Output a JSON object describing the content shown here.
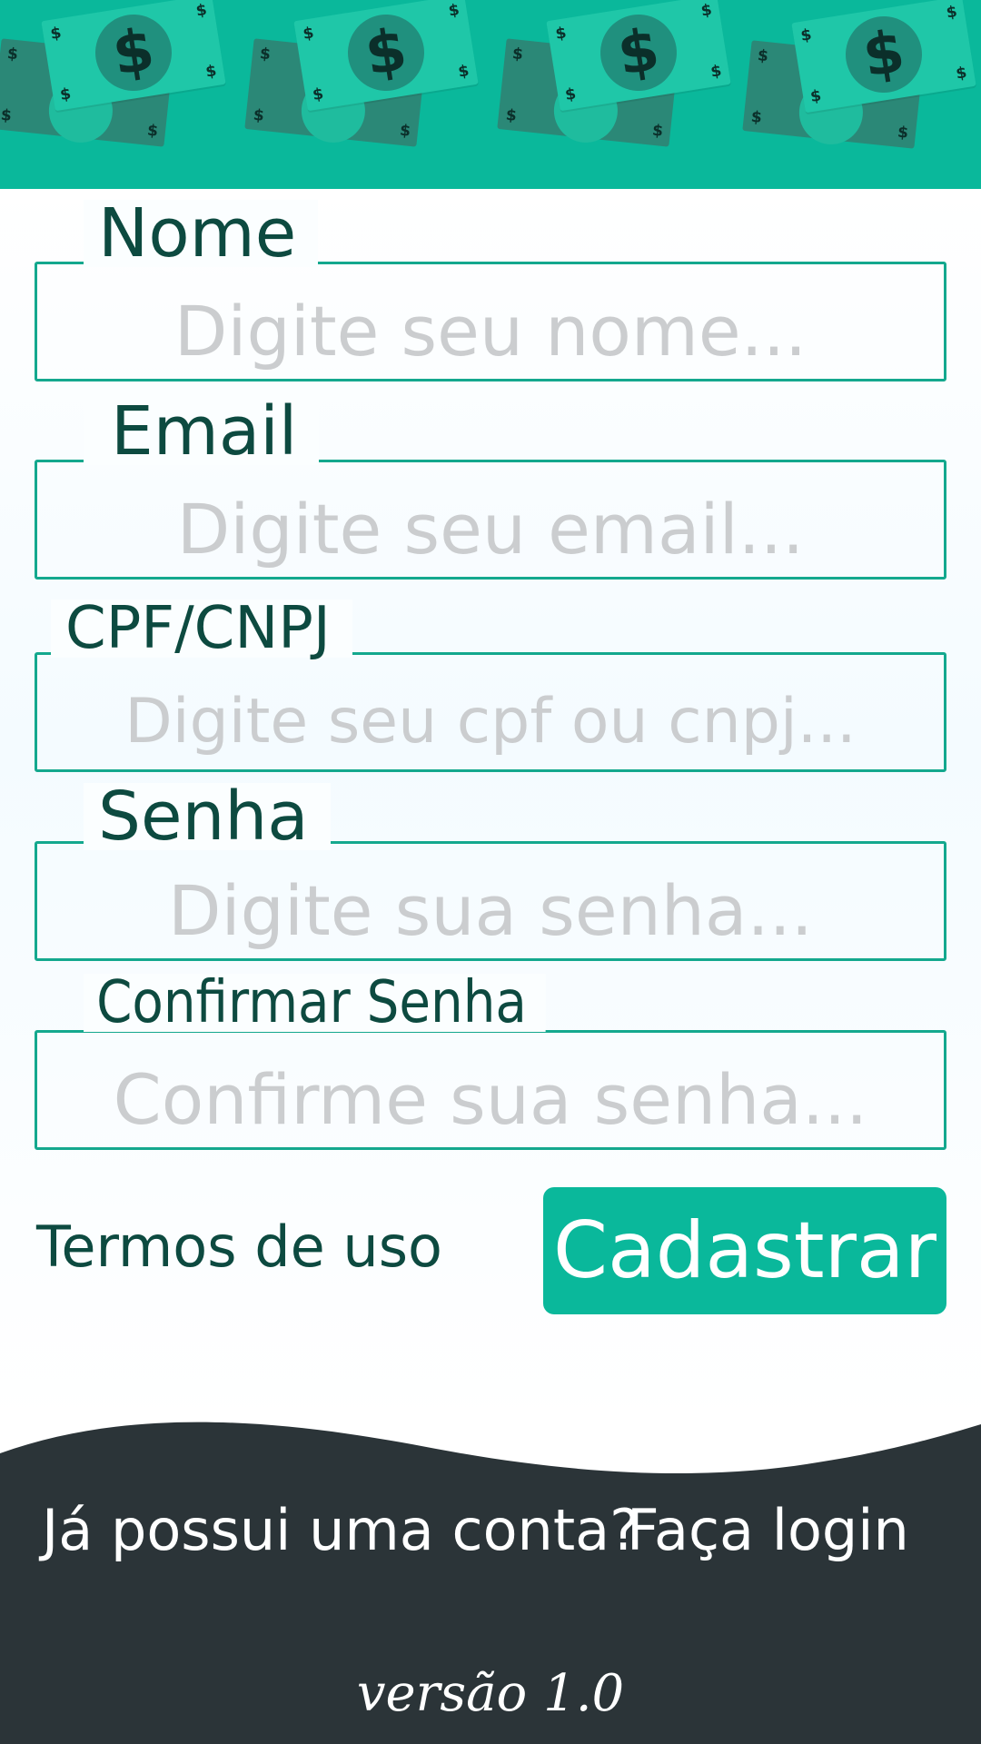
{
  "header": {
    "bill_symbol": "$",
    "background_color": "#0ab89b"
  },
  "form": {
    "fields": [
      {
        "label": "Nome",
        "placeholder": "Digite seu nome..."
      },
      {
        "label": "Email",
        "placeholder": "Digite seu email..."
      },
      {
        "label": "CPF/CNPJ",
        "placeholder": "Digite seu cpf ou cnpj..."
      },
      {
        "label": "Senha",
        "placeholder": "Digite sua senha..."
      },
      {
        "label": "Confirmar Senha",
        "placeholder": "Confirme sua senha..."
      }
    ],
    "terms_label": "Termos de uso",
    "submit_label": "Cadastrar",
    "accent_color": "#0ab89b"
  },
  "footer": {
    "account_prompt": "Já possui uma conta?",
    "login_label": "Faça login",
    "version": "versão 1.0",
    "background_color": "#2b3438"
  }
}
